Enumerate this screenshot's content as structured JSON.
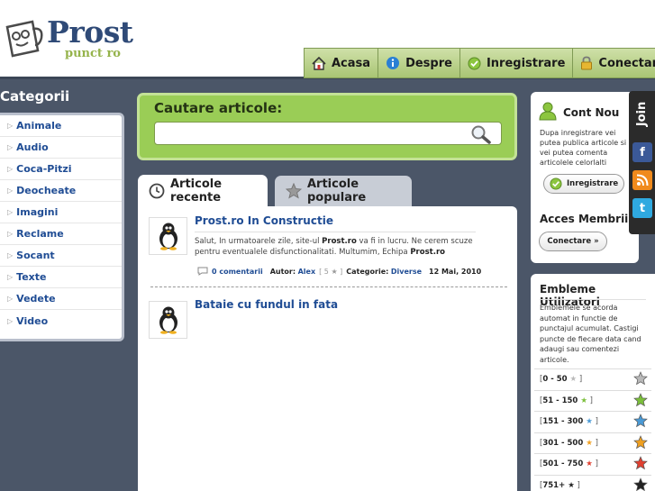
{
  "brand": {
    "name": "Prost",
    "sub": "punct ro"
  },
  "nav": [
    {
      "label": "Acasa",
      "icon": "house-icon"
    },
    {
      "label": "Despre",
      "icon": "info-icon"
    },
    {
      "label": "Inregistrare",
      "icon": "check-icon"
    },
    {
      "label": "Conectare",
      "icon": "lock-icon"
    }
  ],
  "categories": {
    "title": "Categorii",
    "items": [
      "Animale",
      "Audio",
      "Coca-Pitzi",
      "Deocheate",
      "Imagini",
      "Reclame",
      "Socant",
      "Texte",
      "Vedete",
      "Video"
    ]
  },
  "search": {
    "title": "Cautare articole:",
    "value": ""
  },
  "tabs": [
    {
      "label": "Articole recente",
      "icon": "clock-icon"
    },
    {
      "label": "Articole populare",
      "icon": "star-icon"
    }
  ],
  "articles": [
    {
      "title": "Prost.ro In Constructie",
      "body_pre": "Salut, In urmatoarele zile, site-ul ",
      "body_b1": "Prost.ro",
      "body_mid": " va fi in lucru. Ne cerem scuze pentru eventualele disfunctionalitati. Multumim, Echipa ",
      "body_b2": "Prost.ro",
      "comments": "0 comentarii",
      "author_label": "Autor:",
      "author": "Alex",
      "rating": "[ 5 ★ ]",
      "category_label": "Categorie:",
      "category": "Diverse",
      "date": "12 Mai, 2010"
    },
    {
      "title": "Bataie cu fundul in fata"
    }
  ],
  "account": {
    "title": "Cont Nou",
    "text": "Dupa inregistrare vei putea publica articole si vei putea comenta articolele celorlalti utilizatori.",
    "register_label": "Inregistrare",
    "members_title": "Acces Membrii",
    "connect_label": "Conectare »"
  },
  "social": {
    "join": "Join",
    "items": [
      "f",
      "rss",
      "t"
    ]
  },
  "emblems": {
    "title": "Embleme Utilizatori",
    "text": "Emblemele se acorda automat in functie de punctajul acumulat. Castigi puncte de fiecare data cand adaugi sau comentezi articole.",
    "levels": [
      {
        "range": "0 - 50",
        "color": "#b9b9b9"
      },
      {
        "range": "51 - 150",
        "color": "#7bbf3a"
      },
      {
        "range": "151 - 300",
        "color": "#4a9ad6"
      },
      {
        "range": "301 - 500",
        "color": "#f0a020"
      },
      {
        "range": "501 - 750",
        "color": "#e04030"
      },
      {
        "range": "751+",
        "color": "#222222"
      }
    ]
  }
}
